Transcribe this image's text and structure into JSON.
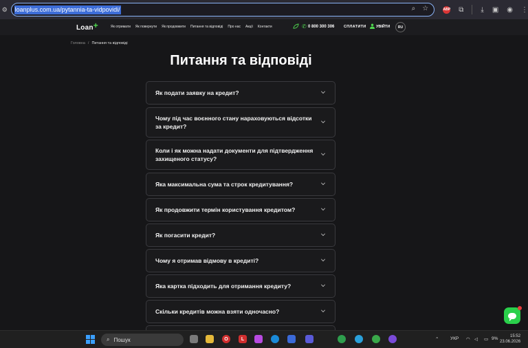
{
  "browser": {
    "url": "loanplus.com.ua/pytannia-ta-vidpovidi/"
  },
  "header": {
    "logo": "Loan",
    "logo_plus": "+",
    "nav": [
      "Як отримати",
      "Як повернути",
      "Як продовжити",
      "Питання та відповіді",
      "Про нас",
      "Акції",
      "Контакти"
    ],
    "phone": "0 800 300 306",
    "pay": "СПЛАТИТИ",
    "login": "УВІЙТИ",
    "lang": "RU"
  },
  "breadcrumb": {
    "home": "Головна",
    "separator": "/",
    "current": "Питання та відповіді"
  },
  "page_title": "Питання та відповіді",
  "faq": [
    "Як подати заявку на кредит?",
    "Чому під час воєнного стану нараховуються відсотки за кредит?",
    "Коли і як можна надати документи для підтвердження захищеного статусу?",
    "Яка максимальна сума та строк кредитування?",
    "Як продовжити термін користування кредитом?",
    "Як погасити кредит?",
    "Чому я отримав відмову в кредиті?",
    "Яка картка підходить для отримання кредиту?",
    "Скільки кредитів можна взяти одночасно?"
  ],
  "taskbar": {
    "search_placeholder": "Пошук",
    "lang": "УКР",
    "battery": "9%",
    "time": "15:52",
    "date": "23.06.2026"
  },
  "colors": {
    "accent": "#4fd84f",
    "background": "#161618",
    "chat": "#2ad04b"
  }
}
